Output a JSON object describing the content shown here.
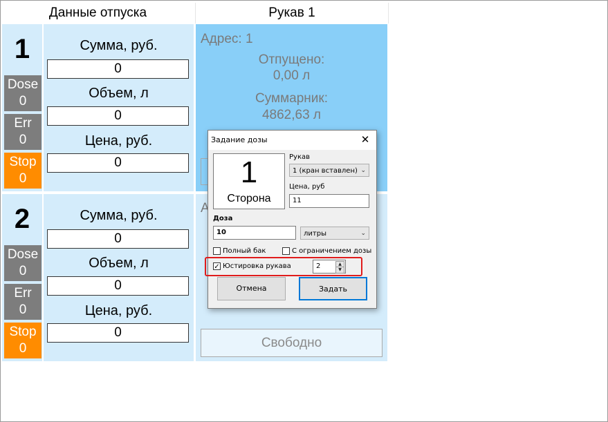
{
  "header": {
    "left_title": "Данные отпуска",
    "right_title": "Рукав 1"
  },
  "sides": [
    {
      "number": "1",
      "dose_label": "Dose",
      "dose_value": "0",
      "err_label": "Err",
      "err_value": "0",
      "stop_label": "Stop",
      "stop_value": "0",
      "sum_label": "Сумма, руб.",
      "sum_value": "0",
      "volume_label": "Объем, л",
      "volume_value": "0",
      "price_label": "Цена, руб.",
      "price_value": "0"
    },
    {
      "number": "2",
      "dose_label": "Dose",
      "dose_value": "0",
      "err_label": "Err",
      "err_value": "0",
      "stop_label": "Stop",
      "stop_value": "0",
      "sum_label": "Сумма, руб.",
      "sum_value": "0",
      "volume_label": "Объем, л",
      "volume_value": "0",
      "price_label": "Цена, руб.",
      "price_value": "0"
    }
  ],
  "hose1": {
    "address": "Адрес: 1",
    "dispensed_label": "Отпущено:",
    "dispensed_value": "0,00 л",
    "total_label": "Суммарник:",
    "total_value": "4862,63 л"
  },
  "hose2": {
    "address_partial": "А",
    "status_button": "Свободно"
  },
  "dialog": {
    "title": "Задание дозы",
    "close_glyph": "✕",
    "side_number": "1",
    "side_label": "Сторона",
    "hose_label": "Рукав",
    "hose_value": "1 (кран вставлен)",
    "price_label": "Цена, руб",
    "price_value": "11",
    "dose_label": "Доза",
    "dose_value": "10",
    "unit_value": "литры",
    "full_tank_label": "Полный бак",
    "limit_label": "С ограничением дозы",
    "calibration_label": "Юстировка рукава",
    "calibration_check": "✓",
    "calibration_value": "2",
    "cancel_label": "Отмена",
    "submit_label": "Задать",
    "accent_color": "#0078d7",
    "highlight_color": "#e01b1b"
  }
}
